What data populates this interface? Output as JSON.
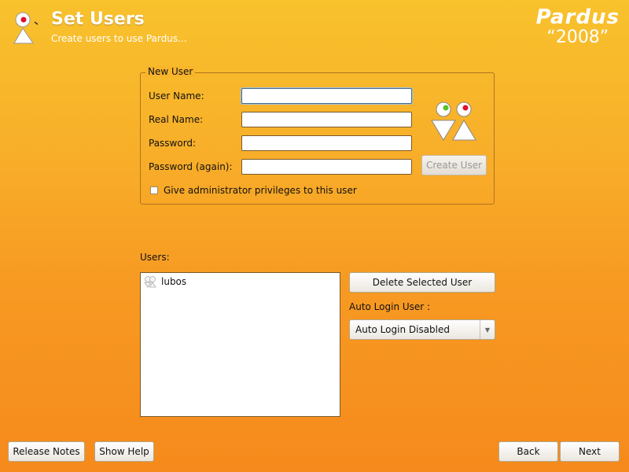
{
  "header": {
    "title": "Set Users",
    "subtitle": "Create users to use Pardus...",
    "brand_name": "Pardus",
    "brand_year": "“2008”"
  },
  "new_user": {
    "group_title": "New User",
    "username_label": "User Name:",
    "username_value": "",
    "realname_label": "Real Name:",
    "realname_value": "",
    "password_label": "Password:",
    "password_value": "",
    "password_again_label": "Password (again):",
    "password_again_value": "",
    "create_button": "Create User",
    "admin_checkbox_label": "Give administrator privileges to this user",
    "admin_checked": false
  },
  "users": {
    "label": "Users:",
    "items": [
      {
        "name": "lubos"
      }
    ],
    "delete_button": "Delete Selected User",
    "auto_login_label": "Auto Login User :",
    "auto_login_selected": "Auto Login Disabled"
  },
  "footer": {
    "release_notes": "Release Notes",
    "show_help": "Show Help",
    "back": "Back",
    "next": "Next"
  },
  "colors": {
    "background_top": "#f8c22c",
    "background_bottom": "#f68a1c",
    "accent_red": "#e0102a",
    "accent_green": "#5ac02a"
  }
}
